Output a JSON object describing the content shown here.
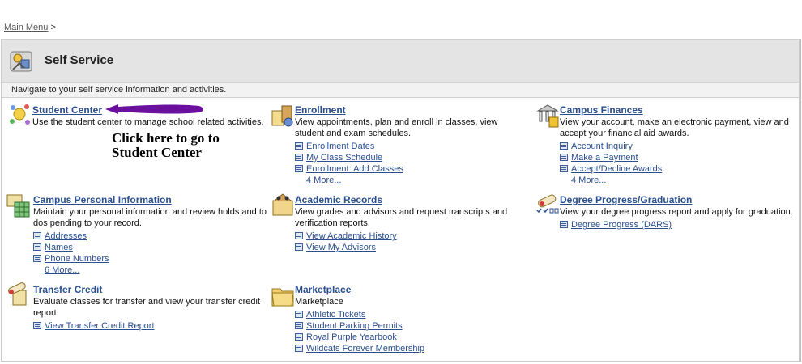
{
  "breadcrumb": {
    "link": "Main Menu",
    "sep": ">"
  },
  "header": {
    "title": "Self Service",
    "icon": "self-service-icon"
  },
  "subheader": {
    "text": "Navigate to your self service information and activities."
  },
  "annotation": {
    "line1": "Click here to go to",
    "line2": "Student Center"
  },
  "categories": {
    "student_center": {
      "title": "Student Center",
      "icon": "student-center-icon",
      "desc": "Use the student center to manage school related activities.",
      "links": []
    },
    "enrollment": {
      "title": "Enrollment",
      "icon": "enrollment-icon",
      "desc": "View appointments, plan and enroll in classes, view student and exam schedules.",
      "links": [
        "Enrollment Dates",
        "My Class Schedule",
        "Enrollment: Add Classes"
      ],
      "more": "4 More..."
    },
    "finances": {
      "title": "Campus Finances",
      "icon": "campus-finances-icon",
      "desc": "View your account, make an electronic payment, view and accept your financial aid awards.",
      "links": [
        "Account Inquiry",
        "Make a Payment",
        "Accept/Decline Awards"
      ],
      "more": "4 More..."
    },
    "personal": {
      "title": "Campus Personal Information",
      "icon": "personal-info-icon",
      "desc": "Maintain your personal information and review holds and to dos pending to your record.",
      "links": [
        "Addresses",
        "Names",
        "Phone Numbers"
      ],
      "more": "6 More..."
    },
    "academic": {
      "title": "Academic Records",
      "icon": "academic-records-icon",
      "desc": "View grades and advisors and request transcripts and verification reports.",
      "links": [
        "View Academic History",
        "View My Advisors"
      ]
    },
    "degree": {
      "title": "Degree Progress/Graduation",
      "icon": "degree-progress-icon",
      "desc": "View your degree progress report and apply for graduation.",
      "links": [
        "Degree Progress (DARS)"
      ]
    },
    "transfer": {
      "title": "Transfer Credit",
      "icon": "transfer-credit-icon",
      "desc": "Evaluate classes for transfer and view your transfer credit report.",
      "links": [
        "View Transfer Credit Report"
      ]
    },
    "marketplace": {
      "title": "Marketplace",
      "icon": "marketplace-icon",
      "desc": "Marketplace",
      "links": [
        "Athletic Tickets",
        "Student Parking Permits",
        "Royal Purple Yearbook",
        "Wildcats Forever Membership"
      ]
    }
  },
  "colors": {
    "link": "#2a4e8e",
    "header_bg": "#e4e4e4",
    "arrow": "#6a0f9e"
  }
}
